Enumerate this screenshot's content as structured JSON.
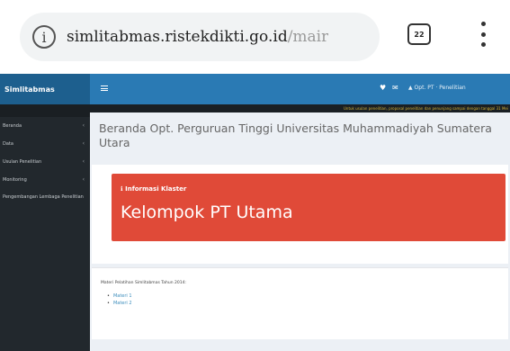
{
  "browser": {
    "url_host": "simlitabmas.ristekdikti.go.id",
    "url_path": "/mair",
    "tab_count": "22",
    "info_icon": "info-circle-icon",
    "menu_icon": "kebab-menu-icon"
  },
  "sidebar": {
    "brand": "Simlitabmas",
    "items": [
      {
        "label": "Beranda"
      },
      {
        "label": "Data"
      },
      {
        "label": "Usulan Penelitian"
      },
      {
        "label": "Monitoring"
      },
      {
        "label": "Pengembangan Lembaga Penelitian"
      }
    ]
  },
  "navbar": {
    "menu_icon": "hamburger-icon",
    "user_label": "Opt. PT · Penelitian"
  },
  "notice": {
    "text": "Untuk usulan penelitian, proposal penelitian dan penunjang sampai dengan tanggal 31 Mei"
  },
  "page": {
    "title": "Beranda Opt. Perguruan Tinggi Universitas Muhammadiyah Sumatera Utara"
  },
  "cluster": {
    "label": "Informasi Klaster",
    "value": "Kelompok PT Utama"
  },
  "materi": {
    "heading": "Materi Pelatihan Simlitabmas Tahun 2014:",
    "items": [
      "Materi 1",
      "Materi 2"
    ]
  },
  "colors": {
    "brand": "#1d5f8e",
    "navbar": "#2a7ab4",
    "sidebar": "#22282d",
    "cluster": "#e04a38",
    "content_bg": "#ecf0f5"
  }
}
